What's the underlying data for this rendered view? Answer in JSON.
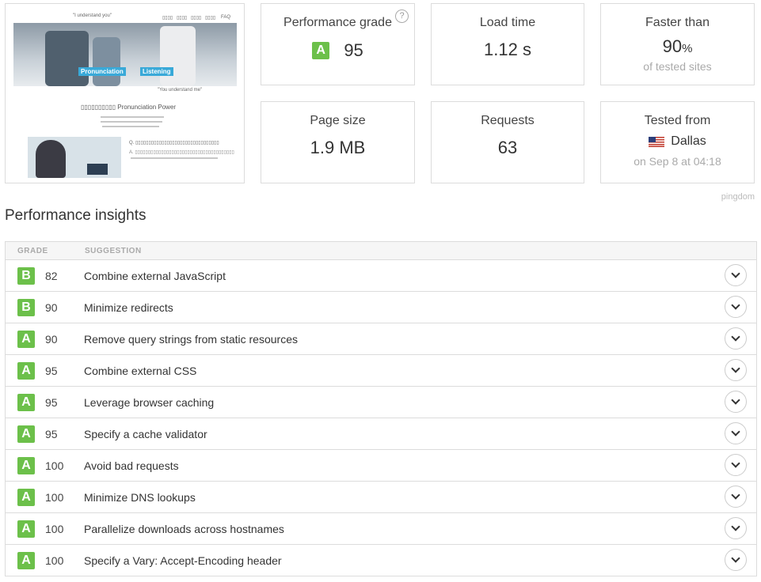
{
  "screenshot": {
    "top_nav": [
      "▯▯▯▯",
      "▯▯▯▯",
      "▯▯▯▯",
      "▯▯▯▯",
      "FAQ"
    ],
    "quote_top": "\"I understand you\"",
    "quote_bottom": "\"You understand me\"",
    "tag_left": "Pronunciation",
    "tag_right": "Listening",
    "heading": "▯▯▯▯▯▯▯▯▯▯ Pronunciation Power",
    "qa_q": "Q. ▯▯▯▯▯▯▯▯▯▯▯▯▯▯▯▯▯▯▯▯▯▯▯▯▯▯▯▯▯▯▯▯",
    "qa_a": "A. ▯▯▯▯▯▯▯▯▯▯▯▯▯▯▯▯▯▯▯▯▯▯▯▯▯▯▯▯▯▯▯▯▯▯▯▯▯▯"
  },
  "summary": {
    "grade": {
      "title": "Performance grade",
      "letter": "A",
      "value": "95",
      "help": "?"
    },
    "load_time": {
      "title": "Load time",
      "value": "1.12 s"
    },
    "faster": {
      "title": "Faster than",
      "value": "90",
      "unit": "%",
      "sub": "of tested sites"
    },
    "page_size": {
      "title": "Page size",
      "value": "1.9 MB"
    },
    "requests": {
      "title": "Requests",
      "value": "63"
    },
    "tested": {
      "title": "Tested from",
      "location": "Dallas",
      "when": "on Sep 8 at 04:18"
    }
  },
  "brand": "pingdom",
  "insights": {
    "title": "Performance insights",
    "col_grade": "GRADE",
    "col_suggestion": "SUGGESTION",
    "rows": [
      {
        "letter": "B",
        "score": "82",
        "text": "Combine external JavaScript"
      },
      {
        "letter": "B",
        "score": "90",
        "text": "Minimize redirects"
      },
      {
        "letter": "A",
        "score": "90",
        "text": "Remove query strings from static resources"
      },
      {
        "letter": "A",
        "score": "95",
        "text": "Combine external CSS"
      },
      {
        "letter": "A",
        "score": "95",
        "text": "Leverage browser caching"
      },
      {
        "letter": "A",
        "score": "95",
        "text": "Specify a cache validator"
      },
      {
        "letter": "A",
        "score": "100",
        "text": "Avoid bad requests"
      },
      {
        "letter": "A",
        "score": "100",
        "text": "Minimize DNS lookups"
      },
      {
        "letter": "A",
        "score": "100",
        "text": "Parallelize downloads across hostnames"
      },
      {
        "letter": "A",
        "score": "100",
        "text": "Specify a Vary: Accept-Encoding header"
      }
    ]
  },
  "colors": {
    "grade_green": "#6cc04a"
  }
}
